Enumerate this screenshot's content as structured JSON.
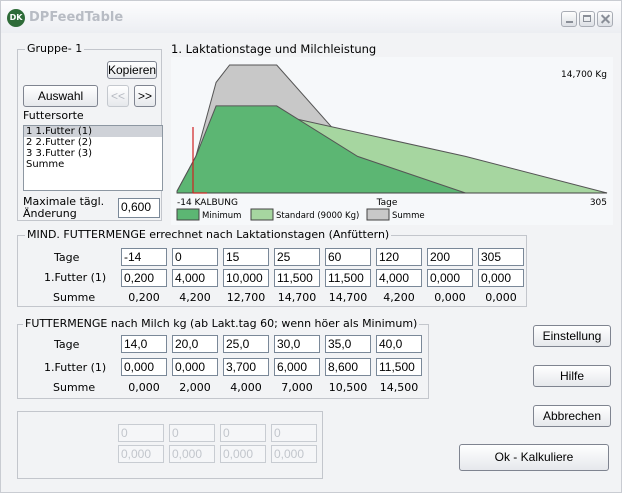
{
  "window": {
    "title": "DPFeedTable",
    "icon_text": "DK"
  },
  "gruppe": {
    "label": "Gruppe- 1",
    "kopieren": "Kopieren",
    "auswahl": "Auswahl",
    "prev": "<<",
    "next": ">>",
    "futtersorte_label": "Futtersorte",
    "futtersorte_items": [
      "1 1.Futter (1)",
      "2 2.Futter (2)",
      "3 3.Futter (3)",
      "Summe"
    ],
    "selected_index": 0,
    "max_label_1": "Maximale tägl.",
    "max_label_2": "Änderung",
    "max_value": "0,600"
  },
  "chart_data": {
    "type": "area",
    "title": "1. Laktationstage und Milchleistung",
    "annotation": "14,700 Kg",
    "xlabel": "Tage",
    "x_start_label": "-14 KALBUNG",
    "x_end_label": "305",
    "xlim": [
      -14,
      305
    ],
    "series": [
      {
        "name": "Summe",
        "color": "#c8c8c8",
        "x": [
          -14,
          0,
          15,
          25,
          60,
          120,
          305
        ],
        "y": [
          0.2,
          4.2,
          12.7,
          14.7,
          14.7,
          4.2,
          0.0
        ]
      },
      {
        "name": "Standard  (9000 Kg)",
        "color": "#a6d6a0",
        "x": [
          -14,
          0,
          15,
          25,
          60,
          200,
          305
        ],
        "y": [
          0.2,
          4.2,
          9.0,
          9.0,
          9.0,
          4.2,
          0.0
        ]
      },
      {
        "name": "Minimum",
        "color": "#5cb673",
        "x": [
          -14,
          0,
          15,
          25,
          60,
          120,
          200
        ],
        "y": [
          0.2,
          4.2,
          10.0,
          10.0,
          10.0,
          4.2,
          0.0
        ]
      }
    ]
  },
  "mind": {
    "label": "MIND. FUTTERMENGE  errechnet nach Laktationstagen (Anfüttern)",
    "tage_label": "Tage",
    "futter_label": "1.Futter (1)",
    "summe_label": "Summe",
    "tage": [
      "-14",
      "0",
      "15",
      "25",
      "60",
      "120",
      "200",
      "305"
    ],
    "futter": [
      "0,200",
      "4,000",
      "10,000",
      "11,500",
      "11,500",
      "4,000",
      "0,000",
      "0,000"
    ],
    "summe": [
      "0,200",
      "4,200",
      "12,700",
      "14,700",
      "14,700",
      "4,200",
      "0,000",
      "0,000"
    ]
  },
  "milch": {
    "label": "FUTTERMENGE  nach Milch kg (ab Lakt.tag 60; wenn höer als Minimum)",
    "tage_label": "Tage",
    "futter_label": "1.Futter (1)",
    "summe_label": "Summe",
    "tage": [
      "14,0",
      "20,0",
      "25,0",
      "30,0",
      "35,0",
      "40,0"
    ],
    "futter": [
      "0,000",
      "0,000",
      "3,700",
      "6,000",
      "8,600",
      "11,500"
    ],
    "summe": [
      "0,000",
      "2,000",
      "4,000",
      "7,000",
      "10,500",
      "14,500"
    ]
  },
  "extra": {
    "row1": [
      "0",
      "0",
      "0",
      "0"
    ],
    "row2": [
      "0,000",
      "0,000",
      "0,000",
      "0,000"
    ]
  },
  "buttons": {
    "einstellung": "Einstellung",
    "hilfe": "Hilfe",
    "abbrechen": "Abbrechen",
    "ok": "Ok - Kalkuliere"
  }
}
